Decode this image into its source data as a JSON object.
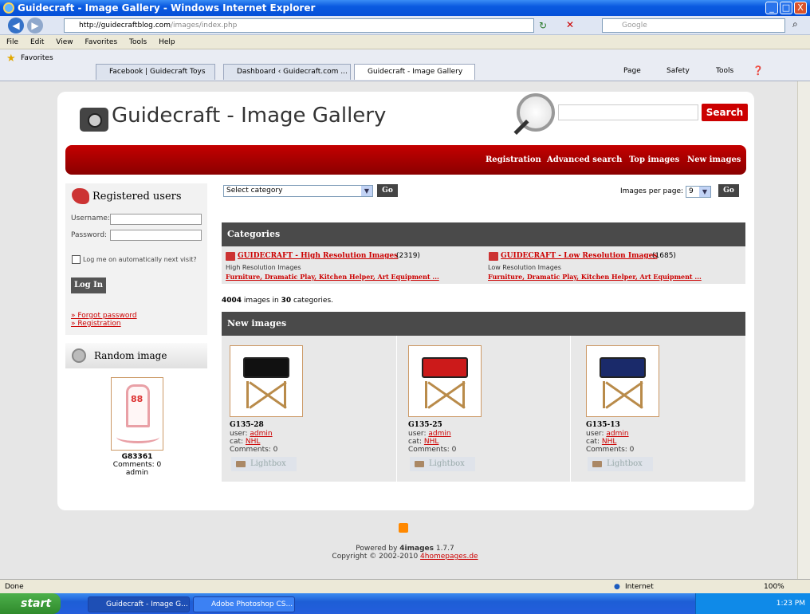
{
  "window": {
    "title": "Guidecraft - Image Gallery - Windows Internet Explorer",
    "controls": [
      "_",
      "□",
      "X"
    ]
  },
  "browser": {
    "address_domain": "http://guidecraftblog.com",
    "address_path": "/images/index.php",
    "search_placeholder": "Google",
    "menu": [
      "File",
      "Edit",
      "View",
      "Favorites",
      "Tools",
      "Help"
    ],
    "favorites_label": "Favorites",
    "tabs": [
      {
        "label": "Facebook | Guidecraft Toys"
      },
      {
        "label": "Dashboard ‹ Guidecraft.com ..."
      },
      {
        "label": "Guidecraft - Image Gallery"
      }
    ],
    "command_items": [
      "Page",
      "Safety",
      "Tools"
    ]
  },
  "site": {
    "title": "Guidecraft - Image Gallery",
    "search_button": "Search",
    "nav": [
      "Registration",
      "Advanced search",
      "Top images",
      "New images"
    ]
  },
  "login": {
    "title": "Registered users",
    "username_label": "Username:",
    "password_label": "Password:",
    "auto_login": "Log me on automatically next visit?",
    "login_button": "Log In",
    "forgot": "» Forgot password",
    "register": "» Registration"
  },
  "random": {
    "title": "Random image",
    "name": "G83361",
    "comments": "Comments: 0",
    "user": "admin"
  },
  "toolbar": {
    "category_select": "Select category",
    "go": "Go",
    "per_page_label": "Images per page:",
    "per_page_value": "9"
  },
  "categories": {
    "title": "Categories",
    "items": [
      {
        "name": "GUIDECRAFT - High Resolution Images",
        "count": "(2319)",
        "desc": "High Resolution Images",
        "subs": "Furniture, Dramatic Play, Kitchen Helper, Art Equipment ..."
      },
      {
        "name": "GUIDECRAFT - Low Resolution Images",
        "count": "(1685)",
        "desc": "Low Resolution Images",
        "subs": "Furniture, Dramatic Play, Kitchen Helper, Art Equipment ..."
      }
    ],
    "summary_count": "4004",
    "summary_mid": " images in ",
    "summary_cats": "30",
    "summary_end": " categories."
  },
  "new_images": {
    "title": "New images",
    "items": [
      {
        "code": "G135-28",
        "user_label": "user:",
        "user": "admin",
        "cat_label": "cat:",
        "cat": "NHL",
        "comments": "Comments: 0",
        "lightbox": "Lightbox",
        "color": "#111111"
      },
      {
        "code": "G135-25",
        "user_label": "user:",
        "user": "admin",
        "cat_label": "cat:",
        "cat": "NHL",
        "comments": "Comments: 0",
        "lightbox": "Lightbox",
        "color": "#cc1a1a"
      },
      {
        "code": "G135-13",
        "user_label": "user:",
        "user": "admin",
        "cat_label": "cat:",
        "cat": "NHL",
        "comments": "Comments: 0",
        "lightbox": "Lightbox",
        "color": "#1a2a6a"
      }
    ]
  },
  "footer": {
    "powered": "Powered by ",
    "product": "4images",
    "version": " 1.7.7",
    "copyright": "Copyright © 2002-2010 ",
    "copyright_link": "4homepages.de"
  },
  "status": {
    "left": "Done",
    "zone": "Internet",
    "zoom": "100%"
  },
  "taskbar": {
    "start": "start",
    "items": [
      "Guidecraft - Image G...",
      "Adobe Photoshop CS..."
    ],
    "clock": "1:23 PM"
  },
  "colors": {
    "accent_red": "#c00000",
    "dark_bar": "#4a4a4a"
  }
}
